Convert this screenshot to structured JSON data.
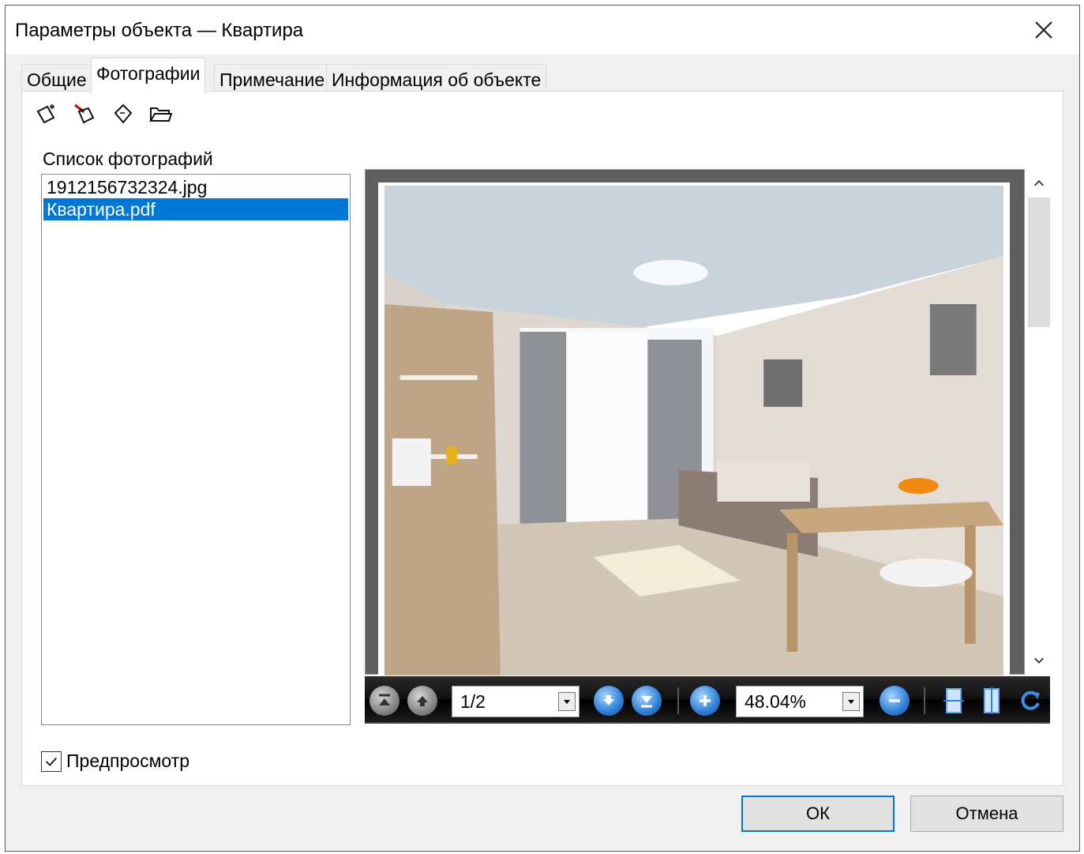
{
  "window": {
    "title": "Параметры объекта — Квартира"
  },
  "tabs": [
    {
      "label": "Общие"
    },
    {
      "label": "Фотографии"
    },
    {
      "label": "Примечание"
    },
    {
      "label": "Информация об объекте"
    }
  ],
  "toolbar": {
    "icons": [
      "new-photo-icon",
      "remove-photo-icon",
      "edit-photo-icon",
      "open-folder-icon"
    ]
  },
  "photos": {
    "label": "Список фотографий",
    "items": [
      "1912156732324.jpg",
      "Квартира.pdf"
    ],
    "selected_index": 1
  },
  "pdf_viewer": {
    "page": "1/2",
    "zoom": "48.04%"
  },
  "preview_checkbox": {
    "label": "Предпросмотр",
    "checked": true
  },
  "buttons": {
    "ok": "ОК",
    "cancel": "Отмена"
  },
  "colors": {
    "selection": "#0078d7",
    "dialog_bg": "#f0f0f0"
  }
}
